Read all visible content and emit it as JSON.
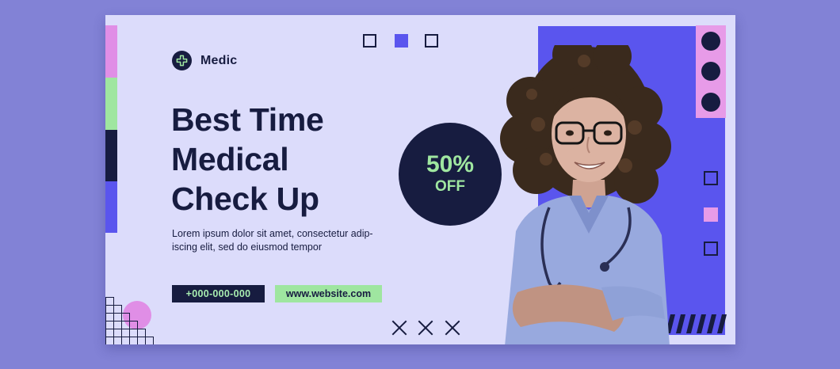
{
  "brand": {
    "name": "Medic",
    "logo_icon": "medical-cross-icon"
  },
  "headline": [
    "Best Time",
    "Medical",
    "Check Up"
  ],
  "body": [
    "Lorem ipsum dolor sit amet, consectetur adip-",
    "iscing elit, sed do eiusmod tempor"
  ],
  "contact": {
    "phone": "+000-000-000",
    "website": "www.website.com"
  },
  "badge": {
    "percent": "50%",
    "label": "OFF"
  },
  "colors": {
    "navy": "#171c40",
    "purple": "#5a55ee",
    "lavender": "#dcdcfb",
    "mint": "#9fe6a0",
    "pink": "#e08ee6"
  }
}
